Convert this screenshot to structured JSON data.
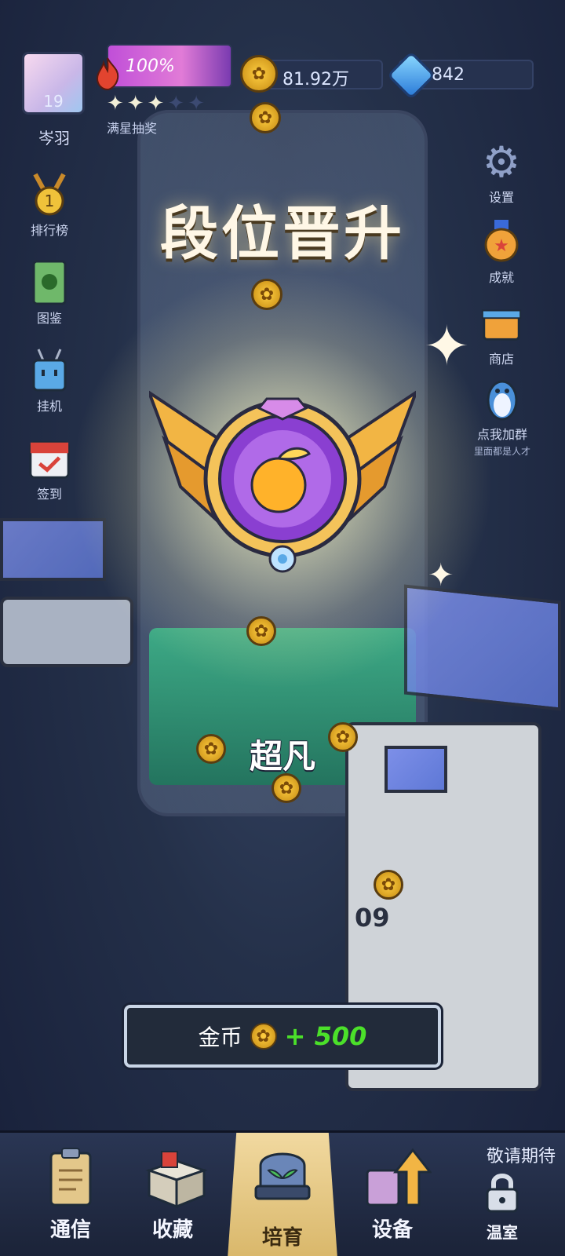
{
  "player": {
    "level": "19",
    "name": "岑羽"
  },
  "energy": {
    "percent": "100%",
    "stars_caption": "满星抽奖",
    "stars_filled": 3,
    "stars_total": 5
  },
  "resources": {
    "coins": "81.92万",
    "gems": "842"
  },
  "side_left": [
    {
      "label": "排行榜",
      "icon": "medal-icon"
    },
    {
      "label": "图鉴",
      "icon": "book-icon"
    },
    {
      "label": "挂机",
      "icon": "robot-icon"
    },
    {
      "label": "签到",
      "icon": "calendar-check-icon"
    }
  ],
  "side_right": [
    {
      "label": "设置",
      "icon": "gear-icon"
    },
    {
      "label": "成就",
      "icon": "star-badge-icon"
    },
    {
      "label": "商店",
      "icon": "shop-icon"
    },
    {
      "label": "点我加群",
      "sublabel": "里面都是人才",
      "icon": "penguin-icon"
    }
  ],
  "center": {
    "headline": "段位晋升",
    "rank_name": "超凡"
  },
  "reward": {
    "label": "金币",
    "amount": "+ 500"
  },
  "nav": [
    {
      "label": "通信",
      "icon": "clipboard-icon",
      "active": false
    },
    {
      "label": "收藏",
      "icon": "box-icon",
      "active": false
    },
    {
      "label": "培育",
      "icon": "sprout-dome-icon",
      "active": true
    },
    {
      "label": "设备",
      "icon": "upgrade-arrow-icon",
      "active": false
    },
    {
      "label": "温室",
      "icon": "lock-icon",
      "active": false,
      "note": "敬请期待"
    }
  ],
  "machine_number": "09",
  "colors": {
    "reward_green": "#4be02a",
    "energy_bar": "#e17bd7",
    "coin_gold": "#ffcf42"
  }
}
